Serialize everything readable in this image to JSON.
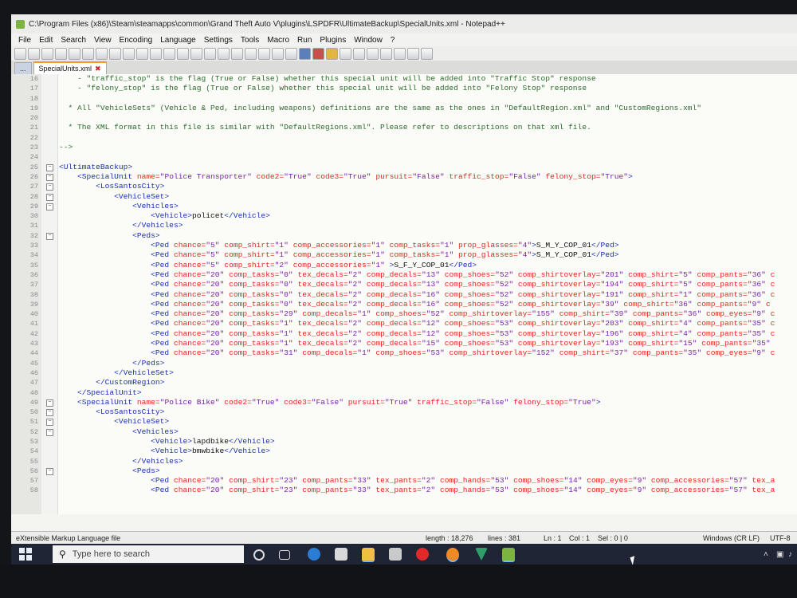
{
  "window": {
    "title": "C:\\Program Files (x86)\\Steam\\steamapps\\common\\Grand Theft Auto V\\plugins\\LSPDFR\\UltimateBackup\\SpecialUnits.xml - Notepad++"
  },
  "menu": [
    "File",
    "Edit",
    "Search",
    "View",
    "Encoding",
    "Language",
    "Settings",
    "Tools",
    "Macro",
    "Run",
    "Plugins",
    "Window",
    "?"
  ],
  "toolbar_icons": [
    "new-icon",
    "open-icon",
    "save-icon",
    "save-all-icon",
    "close-icon",
    "close-all-icon",
    "print-icon",
    "cut-icon",
    "copy-icon",
    "paste-icon",
    "undo-icon",
    "redo-icon",
    "find-icon",
    "replace-icon",
    "zoom-in-icon",
    "zoom-out-icon",
    "sync-v-icon",
    "sync-h-icon",
    "wrap-icon",
    "all-chars-icon",
    "indent-guide-icon",
    "lang-icon",
    "doc-map-icon",
    "function-list-icon",
    "folder-icon",
    "monitor-icon",
    "record-icon",
    "stop-icon",
    "play-icon",
    "play-multi-icon",
    "save-macro-icon"
  ],
  "tabs": [
    {
      "label": "...",
      "active": false
    },
    {
      "label": "SpecialUnits.xml",
      "active": true
    }
  ],
  "lines": [
    {
      "n": "16",
      "html": "<span class='cm'>    - \"traffic_stop\" is the flag (True or False) whether this special unit will be added into \"Traffic Stop\" response</span>"
    },
    {
      "n": "17",
      "html": "<span class='cm'>    - \"felony_stop\" is the flag (True or False) whether this special unit will be added into \"Felony Stop\" response</span>"
    },
    {
      "n": "18",
      "html": ""
    },
    {
      "n": "19",
      "html": "<span class='cm'>  * All \"VehicleSets\" (Vehicle & Ped, including weapons) definitions are the same as the ones in \"DefaultRegion.xml\" and \"CustomRegions.xml\"</span>"
    },
    {
      "n": "20",
      "html": ""
    },
    {
      "n": "21",
      "html": "<span class='cm'>  * The XML format in this file is similar with \"DefaultRegions.xml\". Please refer to descriptions on that xml file.</span>"
    },
    {
      "n": "22",
      "html": ""
    },
    {
      "n": "23",
      "html": "<span class='cm'>--></span>"
    },
    {
      "n": "24",
      "html": ""
    },
    {
      "n": "25",
      "html": "<span class='tg'>&lt;UltimateBackup&gt;</span>"
    },
    {
      "n": "26",
      "html": "    <span class='tg'>&lt;SpecialUnit</span> <span class='at'>name=</span><span class='vl'>\"Police Transporter\"</span> <span class='at'>code2=</span><span class='vl'>\"True\"</span> <span class='at'>code3=</span><span class='vl'>\"True\"</span> <span class='at'>pursuit=</span><span class='vl'>\"False\"</span> <span class='at'>traffic_stop=</span><span class='vl'>\"False\"</span> <span class='at'>felony_stop=</span><span class='vl'>\"True\"</span><span class='tg'>&gt;</span>"
    },
    {
      "n": "27",
      "html": "        <span class='tg'>&lt;LosSantosCity&gt;</span>"
    },
    {
      "n": "28",
      "html": "            <span class='tg'>&lt;VehicleSet&gt;</span>"
    },
    {
      "n": "29",
      "html": "                <span class='tg'>&lt;Vehicles&gt;</span>"
    },
    {
      "n": "30",
      "html": "                    <span class='tg'>&lt;Vehicle&gt;</span><span class='tx'>policet</span><span class='tg'>&lt;/Vehicle&gt;</span>"
    },
    {
      "n": "31",
      "html": "                <span class='tg'>&lt;/Vehicles&gt;</span>"
    },
    {
      "n": "32",
      "html": "                <span class='tg'>&lt;Peds&gt;</span>"
    },
    {
      "n": "33",
      "html": "                    <span class='tg'>&lt;Ped</span> <span class='at'>chance=</span><span class='vl'>\"5\"</span> <span class='at'>comp_shirt=</span><span class='vl'>\"1\"</span> <span class='at'>comp_accessories=</span><span class='vl'>\"1\"</span> <span class='at'>comp_tasks=</span><span class='vl'>\"1\"</span> <span class='at'>prop_glasses=</span><span class='vl'>\"4\"</span><span class='tg'>&gt;</span><span class='tx'>S_M_Y_COP_01</span><span class='tg'>&lt;/Ped&gt;</span>"
    },
    {
      "n": "34",
      "html": "                    <span class='tg'>&lt;Ped</span> <span class='at'>chance=</span><span class='vl'>\"5\"</span> <span class='at'>comp_shirt=</span><span class='vl'>\"1\"</span> <span class='at'>comp_accessories=</span><span class='vl'>\"1\"</span> <span class='at'>comp_tasks=</span><span class='vl'>\"1\"</span> <span class='at'>prop_glasses=</span><span class='vl'>\"4\"</span><span class='tg'>&gt;</span><span class='tx'>S_M_Y_COP_01</span><span class='tg'>&lt;/Ped&gt;</span>"
    },
    {
      "n": "35",
      "html": "                    <span class='tg'>&lt;Ped</span> <span class='at'>chance=</span><span class='vl'>\"5\"</span> <span class='at'>comp_shirt=</span><span class='vl'>\"2\"</span> <span class='at'>comp_accessories=</span><span class='vl'>\"1\"</span> <span class='tg'>&gt;</span><span class='tx'>S_F_Y_COP_01</span><span class='tg'>&lt;/Ped&gt;</span>"
    },
    {
      "n": "36",
      "html": "                    <span class='tg'>&lt;Ped</span> <span class='at'>chance=</span><span class='vl'>\"20\"</span> <span class='at'>comp_tasks=</span><span class='vl'>\"0\"</span> <span class='at'>tex_decals=</span><span class='vl'>\"2\"</span> <span class='at'>comp_decals=</span><span class='vl'>\"13\"</span> <span class='at'>comp_shoes=</span><span class='vl'>\"52\"</span> <span class='at'>comp_shirtoverlay=</span><span class='vl'>\"201\"</span> <span class='at'>comp_shirt=</span><span class='vl'>\"5\"</span> <span class='at'>comp_pants=</span><span class='vl'>\"36\"</span> <span class='at'>c</span>"
    },
    {
      "n": "37",
      "html": "                    <span class='tg'>&lt;Ped</span> <span class='at'>chance=</span><span class='vl'>\"20\"</span> <span class='at'>comp_tasks=</span><span class='vl'>\"0\"</span> <span class='at'>tex_decals=</span><span class='vl'>\"2\"</span> <span class='at'>comp_decals=</span><span class='vl'>\"13\"</span> <span class='at'>comp_shoes=</span><span class='vl'>\"52\"</span> <span class='at'>comp_shirtoverlay=</span><span class='vl'>\"194\"</span> <span class='at'>comp_shirt=</span><span class='vl'>\"5\"</span> <span class='at'>comp_pants=</span><span class='vl'>\"36\"</span> <span class='at'>c</span>"
    },
    {
      "n": "38",
      "html": "                    <span class='tg'>&lt;Ped</span> <span class='at'>chance=</span><span class='vl'>\"20\"</span> <span class='at'>comp_tasks=</span><span class='vl'>\"0\"</span> <span class='at'>tex_decals=</span><span class='vl'>\"2\"</span> <span class='at'>comp_decals=</span><span class='vl'>\"16\"</span> <span class='at'>comp_shoes=</span><span class='vl'>\"52\"</span> <span class='at'>comp_shirtoverlay=</span><span class='vl'>\"191\"</span> <span class='at'>comp_shirt=</span><span class='vl'>\"1\"</span> <span class='at'>comp_pants=</span><span class='vl'>\"36\"</span> <span class='at'>c</span>"
    },
    {
      "n": "39",
      "html": "                    <span class='tg'>&lt;Ped</span> <span class='at'>chance=</span><span class='vl'>\"20\"</span> <span class='at'>comp_tasks=</span><span class='vl'>\"0\"</span> <span class='at'>tex_decals=</span><span class='vl'>\"2\"</span> <span class='at'>comp_decals=</span><span class='vl'>\"16\"</span> <span class='at'>comp_shoes=</span><span class='vl'>\"52\"</span> <span class='at'>comp_shirtoverlay=</span><span class='vl'>\"39\"</span> <span class='at'>comp_shirt=</span><span class='vl'>\"36\"</span> <span class='at'>comp_pants=</span><span class='vl'>\"9\"</span> <span class='at'>c</span>"
    },
    {
      "n": "40",
      "html": "                    <span class='tg'>&lt;Ped</span> <span class='at'>chance=</span><span class='vl'>\"20\"</span> <span class='at'>comp_tasks=</span><span class='vl'>\"29\"</span> <span class='at'>comp_decals=</span><span class='vl'>\"1\"</span> <span class='at'>comp_shoes=</span><span class='vl'>\"52\"</span> <span class='at'>comp_shirtoverlay=</span><span class='vl'>\"155\"</span> <span class='at'>comp_shirt=</span><span class='vl'>\"39\"</span> <span class='at'>comp_pants=</span><span class='vl'>\"36\"</span> <span class='at'>comp_eyes=</span><span class='vl'>\"9\"</span> <span class='at'>c</span>"
    },
    {
      "n": "41",
      "html": "                    <span class='tg'>&lt;Ped</span> <span class='at'>chance=</span><span class='vl'>\"20\"</span> <span class='at'>comp_tasks=</span><span class='vl'>\"1\"</span> <span class='at'>tex_decals=</span><span class='vl'>\"2\"</span> <span class='at'>comp_decals=</span><span class='vl'>\"12\"</span> <span class='at'>comp_shoes=</span><span class='vl'>\"53\"</span> <span class='at'>comp_shirtoverlay=</span><span class='vl'>\"203\"</span> <span class='at'>comp_shirt=</span><span class='vl'>\"4\"</span> <span class='at'>comp_pants=</span><span class='vl'>\"35\"</span> <span class='at'>c</span>"
    },
    {
      "n": "42",
      "html": "                    <span class='tg'>&lt;Ped</span> <span class='at'>chance=</span><span class='vl'>\"20\"</span> <span class='at'>comp_tasks=</span><span class='vl'>\"1\"</span> <span class='at'>tex_decals=</span><span class='vl'>\"2\"</span> <span class='at'>comp_decals=</span><span class='vl'>\"12\"</span> <span class='at'>comp_shoes=</span><span class='vl'>\"53\"</span> <span class='at'>comp_shirtoverlay=</span><span class='vl'>\"196\"</span> <span class='at'>comp_shirt=</span><span class='vl'>\"4\"</span> <span class='at'>comp_pants=</span><span class='vl'>\"35\"</span> <span class='at'>c</span>"
    },
    {
      "n": "43",
      "html": "                    <span class='tg'>&lt;Ped</span> <span class='at'>chance=</span><span class='vl'>\"20\"</span> <span class='at'>comp_tasks=</span><span class='vl'>\"1\"</span> <span class='at'>tex_decals=</span><span class='vl'>\"2\"</span> <span class='at'>comp_decals=</span><span class='vl'>\"15\"</span> <span class='at'>comp_shoes=</span><span class='vl'>\"53\"</span> <span class='at'>comp_shirtoverlay=</span><span class='vl'>\"193\"</span> <span class='at'>comp_shirt=</span><span class='vl'>\"15\"</span> <span class='at'>comp_pants=</span><span class='vl'>\"35\"</span>"
    },
    {
      "n": "44",
      "html": "                    <span class='tg'>&lt;Ped</span> <span class='at'>chance=</span><span class='vl'>\"20\"</span> <span class='at'>comp_tasks=</span><span class='vl'>\"31\"</span> <span class='at'>comp_decals=</span><span class='vl'>\"1\"</span> <span class='at'>comp_shoes=</span><span class='vl'>\"53\"</span> <span class='at'>comp_shirtoverlay=</span><span class='vl'>\"152\"</span> <span class='at'>comp_shirt=</span><span class='vl'>\"37\"</span> <span class='at'>comp_pants=</span><span class='vl'>\"35\"</span> <span class='at'>comp_eyes=</span><span class='vl'>\"9\"</span> <span class='at'>c</span>"
    },
    {
      "n": "45",
      "html": "                <span class='tg'>&lt;/Peds&gt;</span>"
    },
    {
      "n": "46",
      "html": "            <span class='tg'>&lt;/VehicleSet&gt;</span>"
    },
    {
      "n": "47",
      "html": "        <span class='tg'>&lt;/CustomRegion&gt;</span>"
    },
    {
      "n": "48",
      "html": "    <span class='tg'>&lt;/SpecialUnit&gt;</span>"
    },
    {
      "n": "49",
      "html": "    <span class='tg'>&lt;SpecialUnit</span> <span class='at'>name=</span><span class='vl'>\"Police Bike\"</span> <span class='at'>code2=</span><span class='vl'>\"True\"</span> <span class='at'>code3=</span><span class='vl'>\"False\"</span> <span class='at'>pursuit=</span><span class='vl'>\"True\"</span> <span class='at'>traffic_stop=</span><span class='vl'>\"False\"</span> <span class='at'>felony_stop=</span><span class='vl'>\"True\"</span><span class='tg'>&gt;</span>"
    },
    {
      "n": "50",
      "html": "        <span class='tg'>&lt;LosSantosCity&gt;</span>"
    },
    {
      "n": "51",
      "html": "            <span class='tg'>&lt;VehicleSet&gt;</span>"
    },
    {
      "n": "52",
      "html": "                <span class='tg'>&lt;Vehicles&gt;</span>"
    },
    {
      "n": "53",
      "html": "                    <span class='tg'>&lt;Vehicle&gt;</span><span class='tx'>lapdbike</span><span class='tg'>&lt;/Vehicle&gt;</span>"
    },
    {
      "n": "54",
      "html": "                    <span class='tg'>&lt;Vehicle&gt;</span><span class='tx'>bmwbike</span><span class='tg'>&lt;/Vehicle&gt;</span>"
    },
    {
      "n": "55",
      "html": "                <span class='tg'>&lt;/Vehicles&gt;</span>"
    },
    {
      "n": "56",
      "html": "                <span class='tg'>&lt;Peds&gt;</span>"
    },
    {
      "n": "57",
      "html": "                    <span class='tg'>&lt;Ped</span> <span class='at'>chance=</span><span class='vl'>\"20\"</span> <span class='at'>comp_shirt=</span><span class='vl'>\"23\"</span> <span class='at'>comp_pants=</span><span class='vl'>\"33\"</span> <span class='at'>tex_pants=</span><span class='vl'>\"2\"</span> <span class='at'>comp_hands=</span><span class='vl'>\"53\"</span> <span class='at'>comp_shoes=</span><span class='vl'>\"14\"</span> <span class='at'>comp_eyes=</span><span class='vl'>\"9\"</span> <span class='at'>comp_accessories=</span><span class='vl'>\"57\"</span> <span class='at'>tex_a</span>"
    },
    {
      "n": "58",
      "html": "                    <span class='tg'>&lt;Ped</span> <span class='at'>chance=</span><span class='vl'>\"20\"</span> <span class='at'>comp_shirt=</span><span class='vl'>\"23\"</span> <span class='at'>comp_pants=</span><span class='vl'>\"33\"</span> <span class='at'>tex_pants=</span><span class='vl'>\"2\"</span> <span class='at'>comp_hands=</span><span class='vl'>\"53\"</span> <span class='at'>comp_shoes=</span><span class='vl'>\"14\"</span> <span class='at'>comp_eyes=</span><span class='vl'>\"9\"</span> <span class='at'>comp_accessories=</span><span class='vl'>\"57\"</span> <span class='at'>tex_a</span>"
    }
  ],
  "status": {
    "type": "eXtensible Markup Language file",
    "length": "length : 18,276",
    "lines": "lines : 381",
    "ln": "Ln : 1",
    "col": "Col : 1",
    "sel": "Sel : 0 | 0",
    "eol": "Windows (CR LF)",
    "encoding": "UTF-8"
  },
  "taskbar": {
    "search_placeholder": "Type here to search"
  }
}
